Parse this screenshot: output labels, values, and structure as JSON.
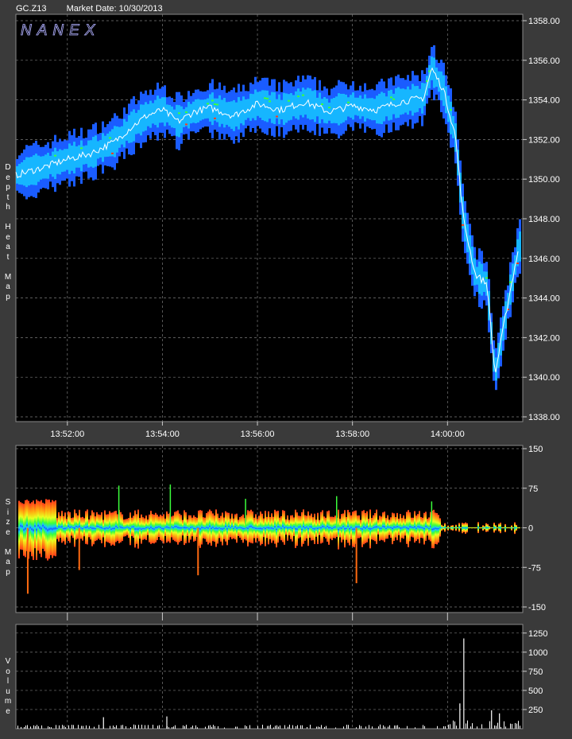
{
  "header": {
    "symbol": "GC.Z13",
    "market_date": "Market Date: 10/30/2013"
  },
  "watermark": "NANEX",
  "colors": {
    "background": "#3a3a3a",
    "plot_bg": "#000000",
    "grid": "#7a7a7a",
    "price_trace": "#ffffff",
    "heat_low": "#1a5cff",
    "heat_mid": "#16c6ff",
    "heat_high": "#3cff3c",
    "heat_peak": "#ff3a1a"
  },
  "chart_data": [
    {
      "type": "heatmap",
      "panel": "depth",
      "ylabel": "Depth Heat Map",
      "x_ticks": [
        "13:52:00",
        "13:54:00",
        "13:56:00",
        "13:58:00",
        "14:00:00"
      ],
      "y_ticks": [
        "1358.00",
        "1356.00",
        "1354.00",
        "1352.00",
        "1350.00",
        "1348.00",
        "1346.00",
        "1344.00",
        "1342.00",
        "1340.00",
        "1338.00"
      ],
      "ylim": [
        1338,
        1358
      ],
      "x_range": [
        "13:50:55",
        "14:01:35"
      ],
      "price": {
        "x": [
          "13:50:55",
          "13:51:30",
          "13:52:00",
          "13:52:30",
          "13:53:00",
          "13:53:20",
          "13:53:40",
          "13:54:00",
          "13:54:20",
          "13:54:40",
          "13:55:00",
          "13:55:30",
          "13:56:00",
          "13:56:30",
          "13:57:00",
          "13:57:30",
          "13:58:00",
          "13:58:30",
          "13:59:00",
          "13:59:30",
          "13:59:40",
          "13:59:55",
          "14:00:10",
          "14:00:20",
          "14:00:35",
          "14:00:50",
          "14:01:00",
          "14:01:15",
          "14:01:30"
        ],
        "y": [
          1350.2,
          1350.6,
          1351.0,
          1351.3,
          1351.9,
          1352.6,
          1353.2,
          1353.5,
          1352.9,
          1353.4,
          1353.6,
          1353.2,
          1353.8,
          1353.5,
          1353.9,
          1353.4,
          1353.7,
          1353.5,
          1353.9,
          1354.1,
          1355.6,
          1354.5,
          1352.2,
          1348.0,
          1345.2,
          1344.7,
          1340.1,
          1343.5,
          1346.6
        ]
      },
      "band_half_width": 1.0
    },
    {
      "type": "area",
      "panel": "size",
      "ylabel": "Size Map",
      "y_ticks": [
        "150",
        "75",
        "0",
        "-75",
        "-150"
      ],
      "ylim": [
        -150,
        150
      ],
      "spikes_up": [
        {
          "x": "13:53:05",
          "y": 80
        },
        {
          "x": "13:54:10",
          "y": 82
        },
        {
          "x": "13:55:45",
          "y": 55
        },
        {
          "x": "13:57:40",
          "y": 60
        },
        {
          "x": "13:59:40",
          "y": 50
        }
      ],
      "spikes_down": [
        {
          "x": "13:51:10",
          "y": -125
        },
        {
          "x": "13:52:15",
          "y": -80
        },
        {
          "x": "13:54:45",
          "y": -90
        },
        {
          "x": "13:58:05",
          "y": -105
        }
      ]
    },
    {
      "type": "bar",
      "panel": "volume",
      "ylabel": "Volume",
      "y_ticks": [
        "1250",
        "1000",
        "750",
        "500",
        "250"
      ],
      "ylim": [
        0,
        1300
      ],
      "spikes": [
        {
          "x": "13:52:45",
          "y": 150
        },
        {
          "x": "13:54:05",
          "y": 160
        },
        {
          "x": "14:00:20",
          "y": 1180
        },
        {
          "x": "14:00:15",
          "y": 330
        },
        {
          "x": "14:00:55",
          "y": 240
        },
        {
          "x": "14:01:05",
          "y": 200
        }
      ]
    }
  ]
}
